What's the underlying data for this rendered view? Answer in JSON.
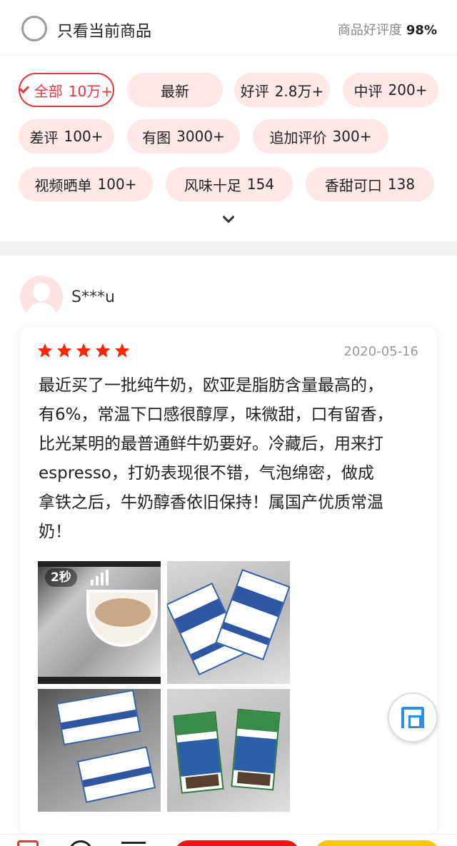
{
  "filter": {
    "only_current_label": "只看当前商品",
    "rating_label": "商品好评度",
    "rating_value": "98%"
  },
  "tags": [
    {
      "label": "全部",
      "count": "10万+",
      "active": true
    },
    {
      "label": "最新",
      "count": "",
      "active": false
    },
    {
      "label": "好评",
      "count": "2.8万+",
      "active": false
    },
    {
      "label": "中评",
      "count": "200+",
      "active": false
    },
    {
      "label": "差评",
      "count": "100+",
      "active": false
    },
    {
      "label": "有图",
      "count": "3000+",
      "active": false
    },
    {
      "label": "追加评价",
      "count": "300+",
      "active": false
    },
    {
      "label": "视频晒单",
      "count": "100+",
      "active": false
    },
    {
      "label": "风味十足",
      "count": "154",
      "active": false
    },
    {
      "label": "香甜可口",
      "count": "138",
      "active": false
    }
  ],
  "review": {
    "username": "S***u",
    "stars": 5,
    "date": "2020-05-16",
    "content_lines": [
      "最近买了一批纯牛奶，欧亚是脂肪含量最高的，",
      "有6%，常温下口感很醇厚，味微甜，口有留香，",
      "比光某明的最普通鲜牛奶要好。冷藏后，用来打",
      "espresso，打奶表现很不错，气泡绵密，做成",
      "拿铁之后，牛奶醇香依旧保持！属国产优质常温",
      "奶！"
    ],
    "video_duration": "2秒",
    "photos": [
      "latte-video",
      "milk-cartons-1",
      "milk-cartons-2",
      "milk-cartons-3"
    ]
  },
  "colors": {
    "accent": "#e4393c",
    "tag_bg": "#fde7e7",
    "star": "#f2270c",
    "qa_blue": "#2b8ee8"
  }
}
